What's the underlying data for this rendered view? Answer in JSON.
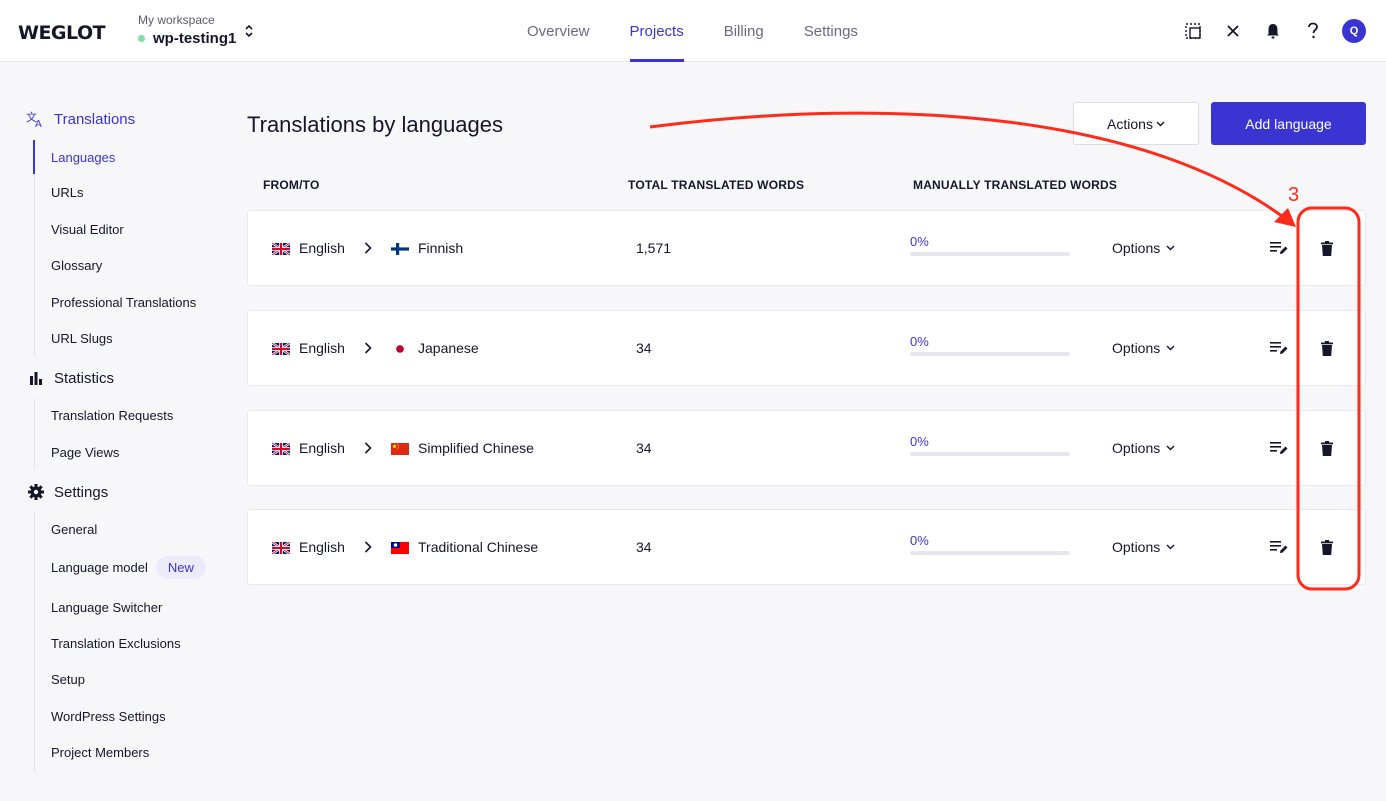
{
  "brand": "WEGLOT",
  "workspace": {
    "label": "My workspace",
    "name": "wp-testing1"
  },
  "nav": {
    "tabs": [
      "Overview",
      "Projects",
      "Billing",
      "Settings"
    ],
    "active": "Projects"
  },
  "user": {
    "initial": "Q"
  },
  "sidebar": {
    "translations": {
      "label": "Translations",
      "items": [
        "Languages",
        "URLs",
        "Visual Editor",
        "Glossary",
        "Professional Translations",
        "URL Slugs"
      ]
    },
    "statistics": {
      "label": "Statistics",
      "items": [
        "Translation Requests",
        "Page Views"
      ]
    },
    "settings": {
      "label": "Settings",
      "items": [
        "General",
        "Language model",
        "Language Switcher",
        "Translation Exclusions",
        "Setup",
        "WordPress Settings",
        "Project Members"
      ],
      "badge": "New"
    }
  },
  "main": {
    "title": "Translations by languages",
    "actions_label": "Actions",
    "add_label": "Add language",
    "columns": [
      "FROM/TO",
      "TOTAL TRANSLATED WORDS",
      "MANUALLY TRANSLATED WORDS"
    ],
    "rows": [
      {
        "from": "English",
        "to": "Finnish",
        "total": "1,571",
        "manual": "0%",
        "manual_fraction": 0,
        "options": "Options"
      },
      {
        "from": "English",
        "to": "Japanese",
        "total": "34",
        "manual": "0%",
        "manual_fraction": 0,
        "options": "Options"
      },
      {
        "from": "English",
        "to": "Simplified Chinese",
        "total": "34",
        "manual": "0%",
        "manual_fraction": 0,
        "options": "Options"
      },
      {
        "from": "English",
        "to": "Traditional Chinese",
        "total": "34",
        "manual": "0%",
        "manual_fraction": 0,
        "options": "Options"
      }
    ]
  },
  "annotation": {
    "step": "3",
    "color": "#ff2a1a"
  },
  "colors": {
    "accent": "#3a34d2",
    "annotation": "#ff2a1a"
  }
}
